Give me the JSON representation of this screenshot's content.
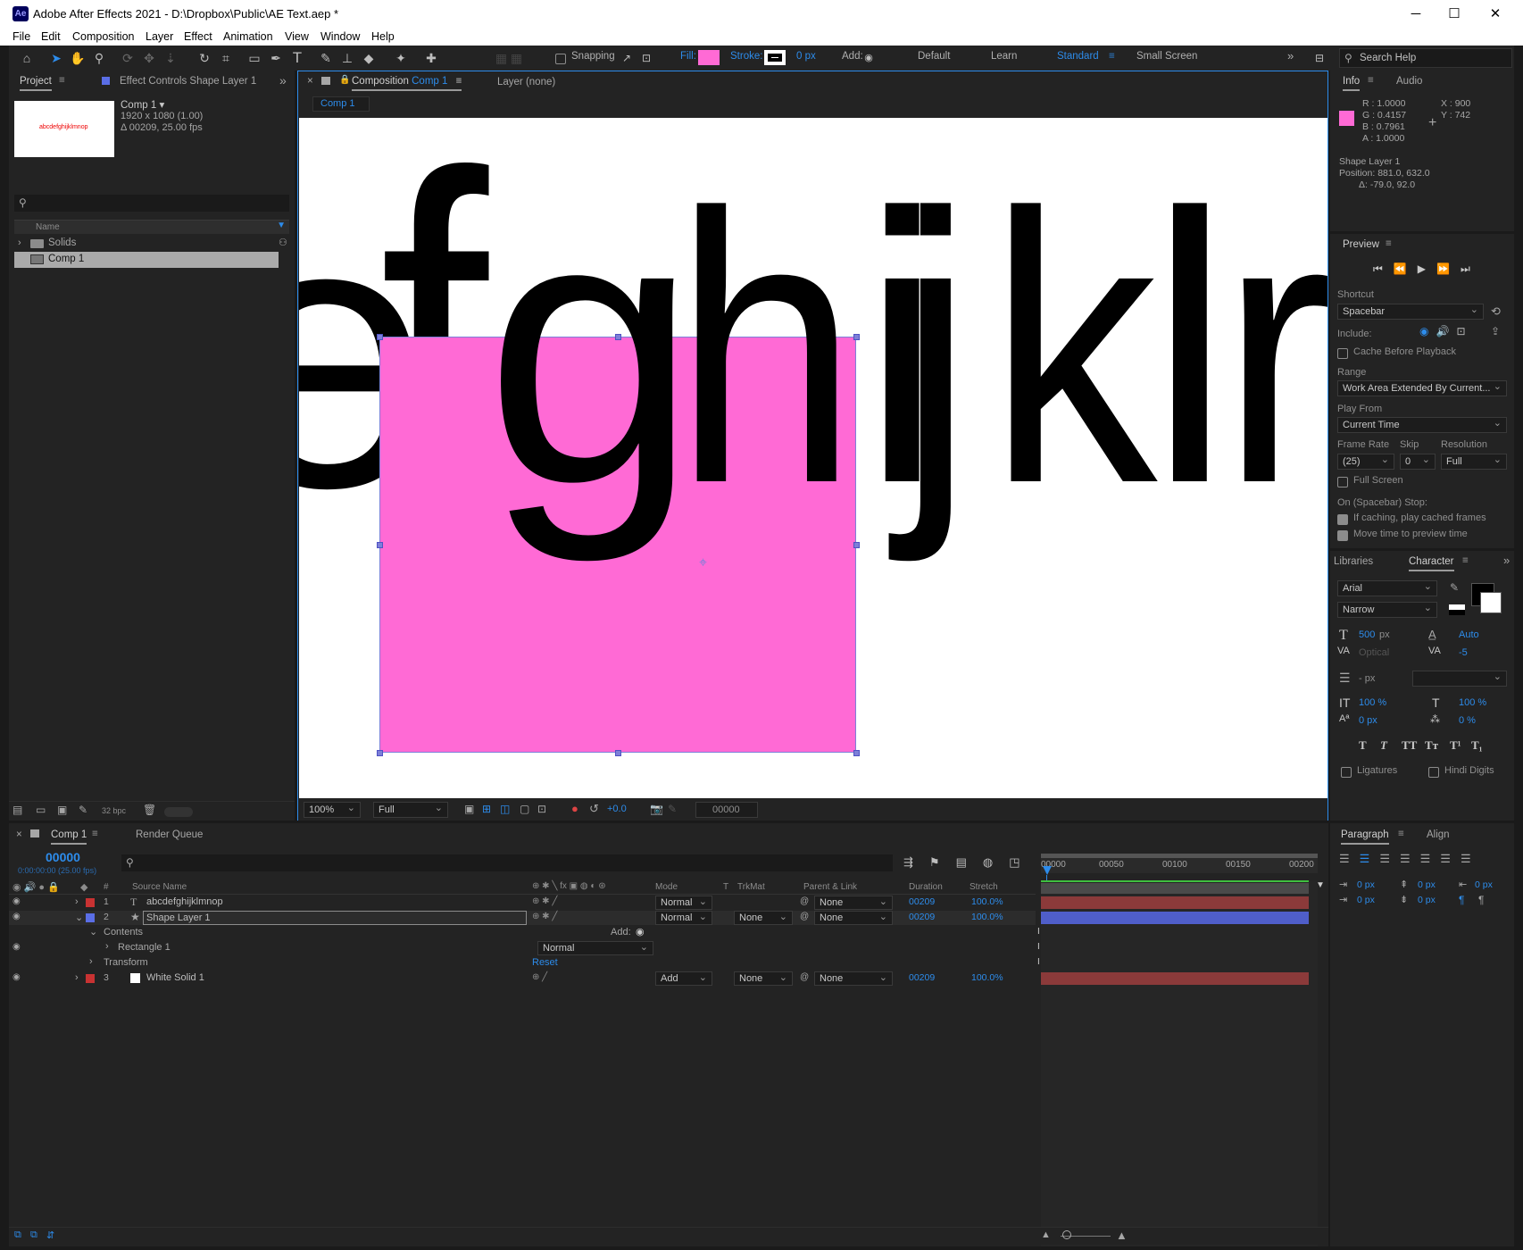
{
  "window": {
    "title": "Adobe After Effects 2021 - D:\\Dropbox\\Public\\AE Text.aep *",
    "app_icon": "Ae",
    "min": "─",
    "max": "☐",
    "close": "✕"
  },
  "menu": [
    "File",
    "Edit",
    "Composition",
    "Layer",
    "Effect",
    "Animation",
    "View",
    "Window",
    "Help"
  ],
  "toolbar": {
    "snapping": "Snapping",
    "fill_label": "Fill:",
    "stroke_label": "Stroke:",
    "stroke_px": "0 px",
    "add_label": "Add:",
    "workspaces": [
      "Default",
      "Learn",
      "Standard",
      "Small Screen"
    ],
    "active_workspace": "Standard",
    "search_placeholder": "Search Help",
    "fill_color": "#ff6ad5"
  },
  "project": {
    "tab": "Project",
    "effect_controls": "Effect Controls Shape Layer 1",
    "thumb_text": "abcdefghijklmnop",
    "comp_name": "Comp 1 ▾",
    "comp_res": "1920 x 1080 (1.00)",
    "comp_dur": "Δ 00209, 25.00 fps",
    "col_name": "Name",
    "items": [
      {
        "name": "Solids",
        "type": "folder"
      },
      {
        "name": "Comp 1",
        "type": "comp",
        "selected": true
      }
    ],
    "bpc": "32 bpc"
  },
  "composition": {
    "tab_prefix": "Composition",
    "tab_name": "Comp 1",
    "layer_tab": "Layer  (none)",
    "crumb": "Comp 1",
    "letters": [
      "e",
      "f",
      "g",
      "h",
      "i",
      "j",
      "k",
      "l",
      "r"
    ],
    "zoom": "100%",
    "resolution": "Full",
    "exposure": "+0.0",
    "timecode": "00000"
  },
  "info": {
    "tab": "Info",
    "tab2": "Audio",
    "r": "R : 1.0000",
    "g": "G : 0.4157",
    "b": "B : 0.7961",
    "a": "A : 1.0000",
    "x": "X : 900",
    "y": "Y : 742",
    "layer": "Shape Layer 1",
    "position": "Position: 881.0, 632.0",
    "delta": "Δ: -79.0, 92.0",
    "swatch": "#ff6ad5"
  },
  "preview": {
    "tab": "Preview",
    "shortcut_label": "Shortcut",
    "shortcut": "Spacebar",
    "include": "Include:",
    "cache": "Cache Before Playback",
    "range_label": "Range",
    "range": "Work Area Extended By Current...",
    "play_from_label": "Play From",
    "play_from": "Current Time",
    "frame_rate_label": "Frame Rate",
    "skip_label": "Skip",
    "resolution_label": "Resolution",
    "frame_rate": "(25)",
    "skip": "0",
    "resolution": "Full",
    "full_screen": "Full Screen",
    "stop_label": "On (Spacebar) Stop:",
    "stop1": "If caching, play cached frames",
    "stop2": "Move time to preview time"
  },
  "character": {
    "tab1": "Libraries",
    "tab2": "Character",
    "font": "Arial",
    "style": "Narrow",
    "size": "500",
    "size_unit": "px",
    "leading": "Auto",
    "kerning": "Optical",
    "tracking": "-5",
    "stroke_w": "- px",
    "vscale": "100 %",
    "hscale": "100 %",
    "baseline": "0 px",
    "tsume": "0 %",
    "styles": [
      "T",
      "T",
      "TT",
      "Tт",
      "T¹",
      "T₁"
    ],
    "ligatures": "Ligatures",
    "hindi": "Hindi Digits"
  },
  "paragraph": {
    "tab": "Paragraph",
    "tab2": "Align",
    "values": [
      "0 px",
      "0 px",
      "0 px",
      "0 px",
      "0 px"
    ]
  },
  "timeline": {
    "tab": "Comp 1",
    "render_queue": "Render Queue",
    "timecode": "00000",
    "timecode_sub": "0:00:00:00 (25.00 fps)",
    "cols": {
      "num": "#",
      "source": "Source Name",
      "mode": "Mode",
      "t": "T",
      "trkmat": "TrkMat",
      "parent": "Parent & Link",
      "duration": "Duration",
      "stretch": "Stretch"
    },
    "ruler": [
      "00000",
      "00050",
      "00100",
      "00150",
      "00200"
    ],
    "layers": [
      {
        "num": "1",
        "name": "abcdefghijklmnop",
        "mode": "Normal",
        "trkmat": "",
        "parent": "None",
        "duration": "00209",
        "stretch": "100.0%",
        "color": "#c83232"
      },
      {
        "num": "2",
        "name": "Shape Layer 1",
        "mode": "Normal",
        "trkmat": "None",
        "parent": "None",
        "duration": "00209",
        "stretch": "100.0%",
        "color": "#5a6ee6"
      },
      {
        "num": "3",
        "name": "White Solid 1",
        "mode": "Add",
        "trkmat": "None",
        "parent": "None",
        "duration": "00209",
        "stretch": "100.0%",
        "color": "#c83232"
      }
    ],
    "contents": "Contents",
    "add": "Add:",
    "rect": "Rectangle 1",
    "rect_mode": "Normal",
    "transform": "Transform",
    "reset": "Reset"
  }
}
